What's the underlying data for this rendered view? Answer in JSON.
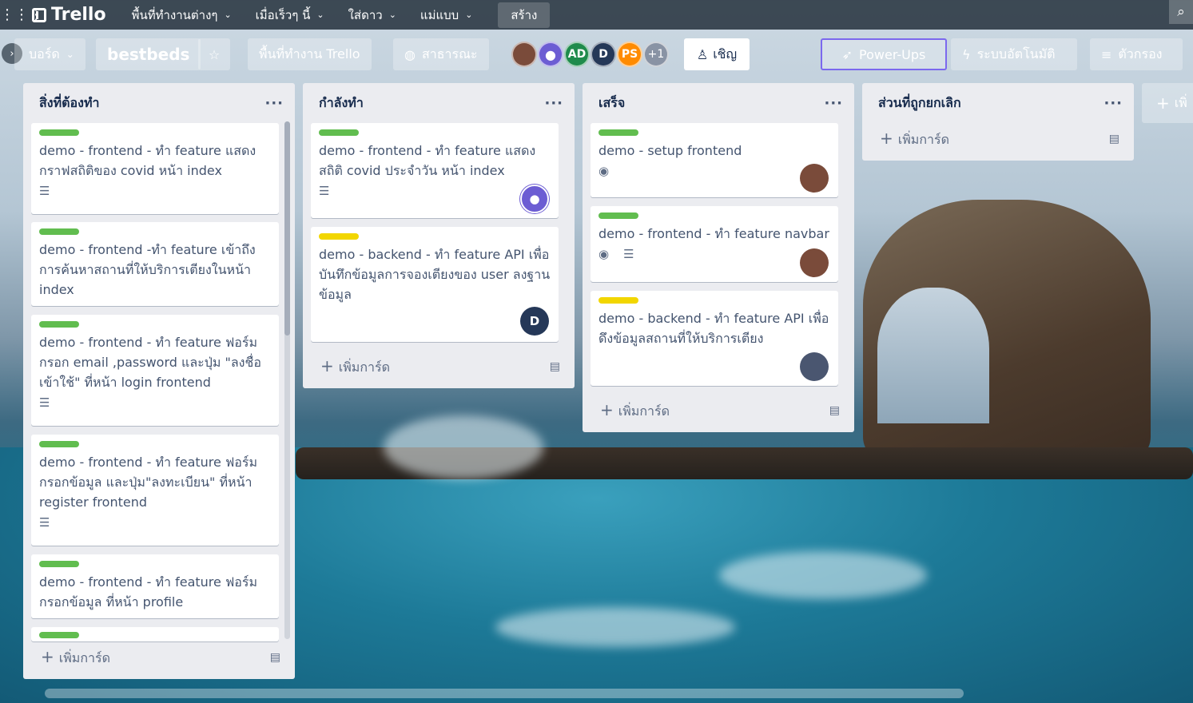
{
  "topbar": {
    "logo": "Trello",
    "menus": [
      "พื้นที่ทำงานต่างๆ",
      "เมื่อเร็วๆ นี้",
      "ใส่ดาว",
      "แม่แบบ"
    ],
    "create": "สร้าง"
  },
  "board_header": {
    "boards_btn": "บอร์ด",
    "board_name": "bestbeds",
    "workspace_btn": "พื้นที่ทำงาน Trello",
    "visibility_btn": "สาธารณะ",
    "members": [
      {
        "initials": "",
        "color": "#7a4b3a"
      },
      {
        "initials": "",
        "color": "#6c5dd3"
      },
      {
        "initials": "AD",
        "color": "#1f8b4c"
      },
      {
        "initials": "D",
        "color": "#253858"
      },
      {
        "initials": "PS",
        "color": "#ff8b00"
      },
      {
        "initials": "+1",
        "color": "#8993a4"
      }
    ],
    "invite": "เชิญ",
    "powerups": "Power-Ups",
    "automation": "ระบบอัตโนมัติ",
    "filter": "ตัวกรอง"
  },
  "lists": [
    {
      "title": "สิ่งที่ต้องทำ",
      "add_card": "เพิ่มการ์ด",
      "cards": [
        {
          "label": "green",
          "text": "demo - frontend - ทำ feature แสดงกราฟสถิติของ covid หน้า index",
          "badges": [
            "description"
          ]
        },
        {
          "label": "green",
          "text": "demo - frontend -ทำ feature เข้าถึงการค้นหาสถานที่ให้บริการเตียงในหน้า index",
          "badges": []
        },
        {
          "label": "green",
          "text": "demo - frontend - ทำ feature ฟอร์มกรอก email ,password และปุ่ม \"ลงชื่อเข้าใช้\" ที่หน้า login frontend",
          "badges": [
            "description"
          ]
        },
        {
          "label": "green",
          "text": "demo - frontend - ทำ feature ฟอร์มกรอกข้อมูล และปุ่ม\"ลงทะเบียน\" ที่หน้า register frontend",
          "badges": [
            "description"
          ]
        },
        {
          "label": "green",
          "text": "demo - frontend - ทำ feature ฟอร์มกรอกข้อมูล ที่หน้า profile",
          "badges": []
        },
        {
          "label": "green",
          "text": "",
          "badges": []
        }
      ]
    },
    {
      "title": "กำลังทำ",
      "add_card": "เพิ่มการ์ด",
      "cards": [
        {
          "label": "green",
          "text": "demo - frontend - ทำ feature แสดงสถิติ covid ประจำวัน หน้า index",
          "badges": [
            "description"
          ],
          "member": ""
        },
        {
          "label": "yellow",
          "text": "demo - backend - ทำ feature API เพื่อบันทึกข้อมูลการจองเตียงของ user ลงฐานข้อมูล",
          "badges": [],
          "member": "D"
        }
      ]
    },
    {
      "title": "เสร็จ",
      "add_card": "เพิ่มการ์ด",
      "cards": [
        {
          "label": "green",
          "text": "demo - setup frontend",
          "badges": [
            "watch"
          ]
        },
        {
          "label": "green",
          "text": "demo - frontend - ทำ feature navbar",
          "badges": [
            "watch",
            "description"
          ]
        },
        {
          "label": "yellow",
          "text": "demo - backend - ทำ feature API เพื่อดึงข้อมูลสถานที่ให้บริการเตียง",
          "badges": []
        }
      ]
    },
    {
      "title": "ส่วนที่ถูกยกเลิก",
      "add_card": "เพิ่มการ์ด",
      "cards": []
    }
  ],
  "add_list": "เพิ่"
}
